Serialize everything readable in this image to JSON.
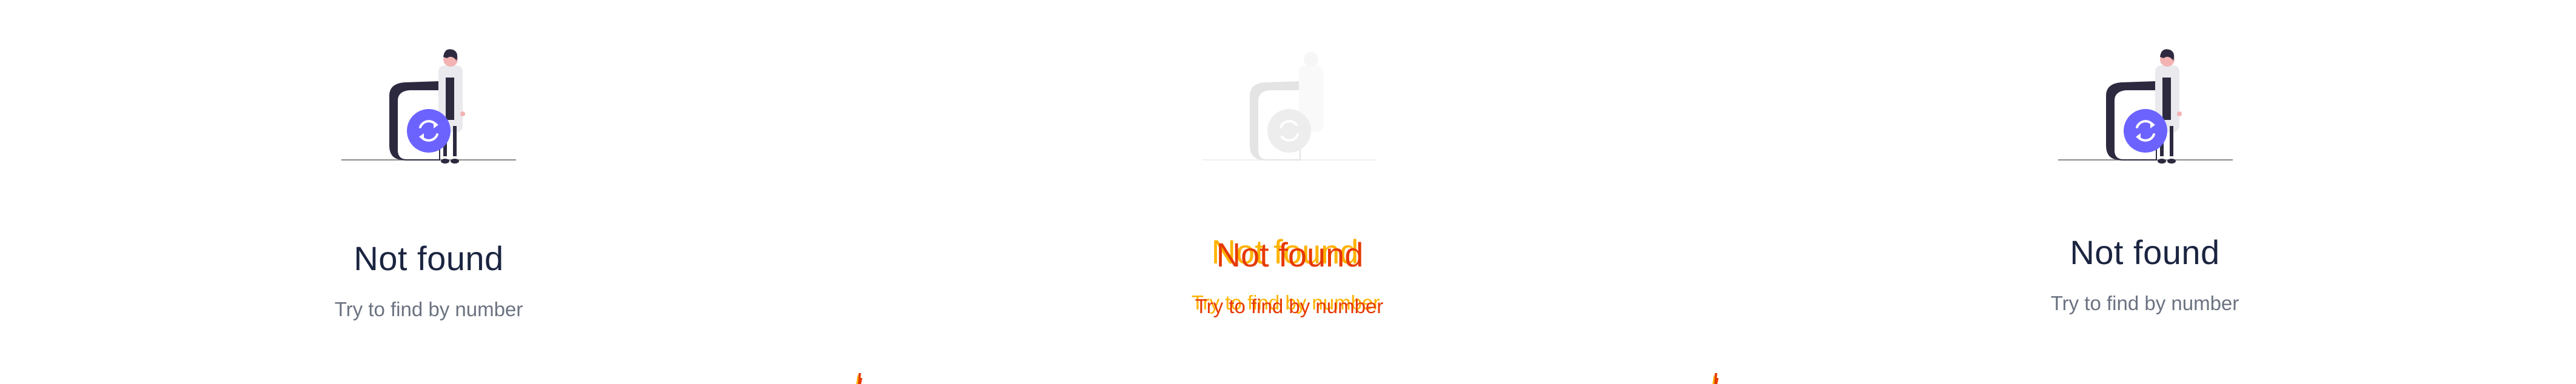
{
  "panels": [
    {
      "id": "left",
      "title": "Not found",
      "subtitle": "Try to find by number",
      "icon": "refresh-icon"
    },
    {
      "id": "middle",
      "title": "Not found",
      "subtitle": "Try to find by number",
      "icon": "refresh-icon",
      "state": "transition"
    },
    {
      "id": "right",
      "title": "Not found",
      "subtitle": "Try to find by number",
      "icon": "refresh-icon"
    }
  ],
  "colors": {
    "accent": "#6c63ff",
    "title": "#1b2440",
    "subtitle": "#6b7280",
    "glitch_red": "#e63900",
    "glitch_yellow": "#ffb300"
  }
}
